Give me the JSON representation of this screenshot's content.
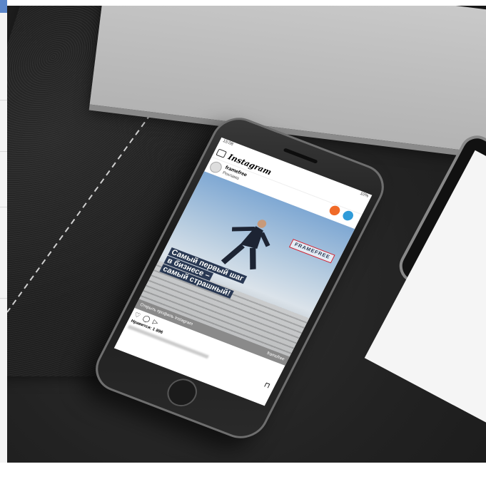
{
  "status": {
    "time": "15:08",
    "right": "10%"
  },
  "instagram": {
    "app_name": "Instagram"
  },
  "post": {
    "account": "framefree",
    "label": "Реклама",
    "brand": "FRAMEFREE",
    "headline": [
      "Самый первый шаг",
      "в бизнесе –",
      "самый страшный!"
    ],
    "cta": "Открыть профиль Instagram",
    "cta_mini": "framefree",
    "likes": "Нравится: 1 896"
  },
  "colors": {
    "badge_orange": "#f06a28",
    "badge_blue": "#2f9bd9",
    "brand_red": "#cc2233"
  }
}
